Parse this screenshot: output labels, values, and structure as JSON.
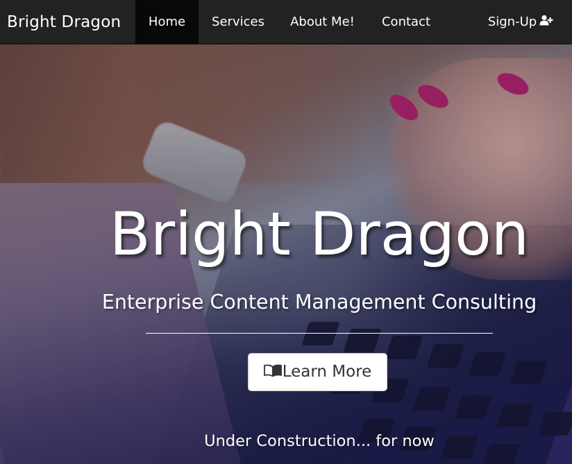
{
  "navbar": {
    "brand": "Bright Dragon",
    "items": [
      {
        "label": "Home",
        "active": true
      },
      {
        "label": "Services"
      },
      {
        "label": "About Me!"
      },
      {
        "label": "Contact"
      }
    ],
    "signup_label": "Sign-Up",
    "signup_icon": "user-plus-icon"
  },
  "hero": {
    "title": "Bright Dragon",
    "subtitle": "Enterprise Content Management Consulting",
    "button_label": "Learn More",
    "button_icon": "book-icon",
    "footer_text": "Under Construction... for now"
  },
  "colors": {
    "navbar_bg": "#222222",
    "navbar_active_bg": "#080808",
    "text": "#ffffff",
    "button_bg": "#ffffff",
    "button_text": "#333333"
  }
}
